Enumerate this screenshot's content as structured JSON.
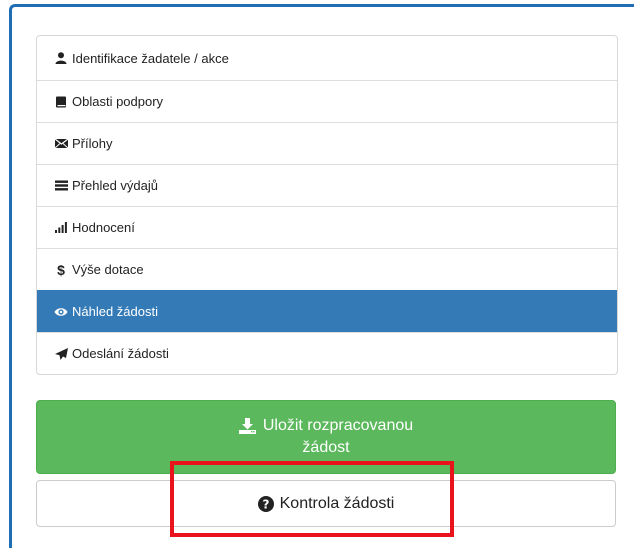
{
  "nav": {
    "items": [
      {
        "label": "Identifikace žadatele / akce",
        "icon": "user-icon",
        "active": false
      },
      {
        "label": "Oblasti podpory",
        "icon": "book-icon",
        "active": false
      },
      {
        "label": "Přílohy",
        "icon": "envelope-icon",
        "active": false
      },
      {
        "label": "Přehled výdajů",
        "icon": "list-icon",
        "active": false
      },
      {
        "label": "Hodnocení",
        "icon": "signal-icon",
        "active": false
      },
      {
        "label": "Výše dotace",
        "icon": "dollar-icon",
        "active": false
      },
      {
        "label": "Náhled žádosti",
        "icon": "eye-icon",
        "active": true
      },
      {
        "label": "Odeslání žádosti",
        "icon": "send-icon",
        "active": false
      }
    ]
  },
  "actions": {
    "save_line1": "Uložit rozpracovanou",
    "save_line2": "žádost",
    "check_label": "Kontrola žádosti"
  },
  "colors": {
    "active_bg": "#337ab7",
    "save_bg": "#5cb85c",
    "highlight": "#e8131b",
    "frame": "#1f6db5"
  }
}
